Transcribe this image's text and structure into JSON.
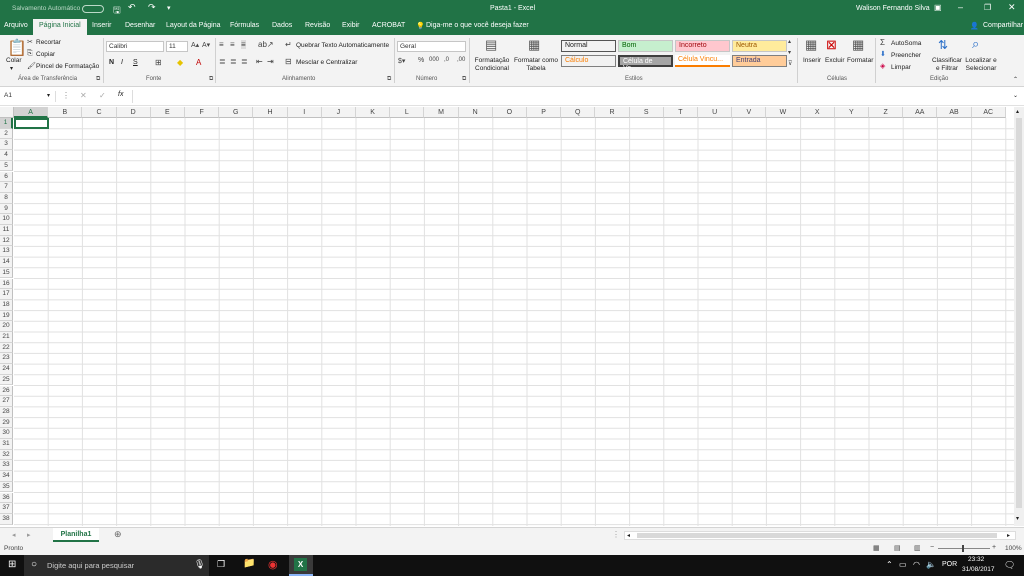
{
  "titlebar": {
    "autosave_label": "Salvamento Automático",
    "autosave_state": "Desativado",
    "doc_title": "Pasta1 - Excel",
    "user_name": "Walison Fernando Silva"
  },
  "tabs": [
    "Arquivo",
    "Página Inicial",
    "Inserir",
    "Desenhar",
    "Layout da Página",
    "Fórmulas",
    "Dados",
    "Revisão",
    "Exibir",
    "ACROBAT"
  ],
  "active_tab": "Página Inicial",
  "tell_me": "Diga-me o que você deseja fazer",
  "share_label": "Compartilhar",
  "clipboard": {
    "paste": "Colar",
    "cut": "Recortar",
    "copy": "Copiar",
    "format_painter": "Pincel de Formatação",
    "group": "Área de Transferência"
  },
  "font": {
    "name": "Calibri",
    "size": "11",
    "bold": "N",
    "italic": "I",
    "underline": "S",
    "group": "Fonte"
  },
  "alignment": {
    "wrap": "Quebrar Texto Automaticamente",
    "merge": "Mesclar e Centralizar",
    "group": "Alinhamento"
  },
  "number": {
    "format": "Geral",
    "group": "Número"
  },
  "styles": {
    "conditional": "Formatação Condicional",
    "as_table": "Formatar como Tabela",
    "cells": [
      {
        "label": "Normal",
        "bg": "#ffffff",
        "fg": "#000000"
      },
      {
        "label": "Bom",
        "bg": "#c6efce",
        "fg": "#006100"
      },
      {
        "label": "Incorreto",
        "bg": "#ffc7ce",
        "fg": "#9c0006"
      },
      {
        "label": "Neutra",
        "bg": "#ffeb9c",
        "fg": "#9c5700"
      },
      {
        "label": "Cálculo",
        "bg": "#f2f2f2",
        "fg": "#fa7d00"
      },
      {
        "label": "Célula de Ve...",
        "bg": "#a5a5a5",
        "fg": "#ffffff"
      },
      {
        "label": "Célula Vincu...",
        "bg": "#ffffff",
        "fg": "#fa7d00"
      },
      {
        "label": "Entrada",
        "bg": "#ffcc99",
        "fg": "#3f3f76"
      }
    ],
    "group": "Estilos"
  },
  "cells_group": {
    "insert": "Inserir",
    "delete": "Excluir",
    "format": "Formatar",
    "group": "Células"
  },
  "editing": {
    "autosum": "AutoSoma",
    "fill": "Preencher",
    "clear": "Limpar",
    "sort": "Classificar e Filtrar",
    "find": "Localizar e Selecionar",
    "group": "Edição"
  },
  "formula_bar": {
    "name_box": "A1",
    "fx": "fx",
    "value": ""
  },
  "columns": [
    "A",
    "B",
    "C",
    "D",
    "E",
    "F",
    "G",
    "H",
    "I",
    "J",
    "K",
    "L",
    "M",
    "N",
    "O",
    "P",
    "Q",
    "R",
    "S",
    "T",
    "U",
    "V",
    "W",
    "X",
    "Y",
    "Z",
    "AA",
    "AB",
    "AC"
  ],
  "rows": [
    "1",
    "2",
    "3",
    "4",
    "5",
    "6",
    "7",
    "8",
    "9",
    "10",
    "11",
    "12",
    "13",
    "14",
    "15",
    "16",
    "17",
    "18",
    "19",
    "20",
    "21",
    "22",
    "23",
    "24",
    "25",
    "26",
    "27",
    "28",
    "29",
    "30",
    "31",
    "32",
    "33",
    "34",
    "35",
    "36",
    "37",
    "38"
  ],
  "sheet_tab": "Planilha1",
  "status": {
    "ready": "Pronto",
    "zoom": "100%"
  },
  "taskbar": {
    "search_placeholder": "Digite aqui para pesquisar",
    "lang": "POR",
    "time": "23:32",
    "date": "31/08/2017"
  },
  "colors": {
    "excel_green": "#217346"
  }
}
